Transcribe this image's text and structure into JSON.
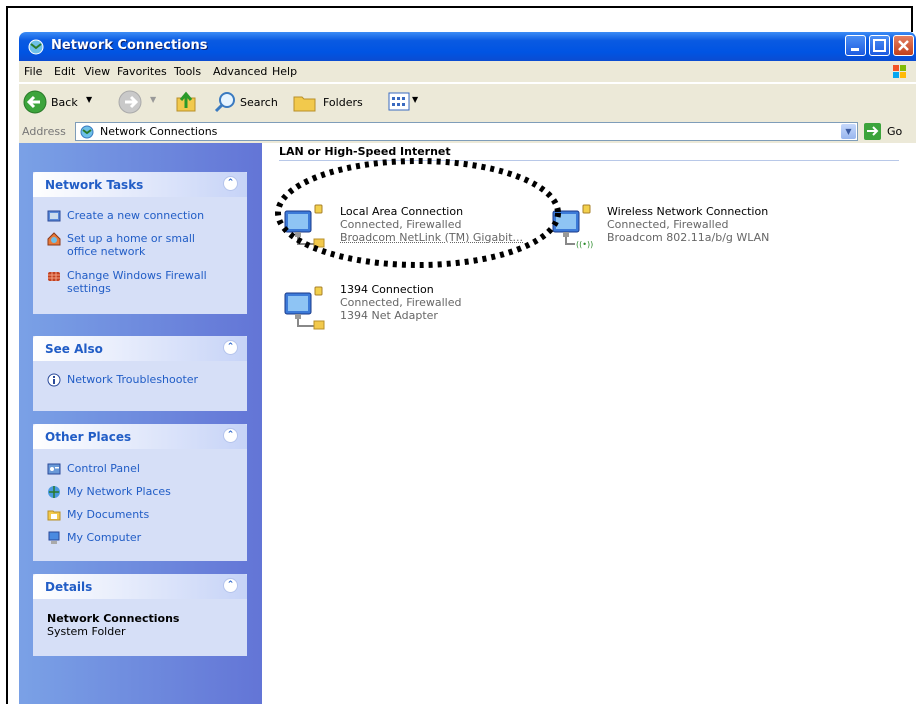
{
  "window": {
    "title": "Network Connections"
  },
  "menu": [
    "File",
    "Edit",
    "View",
    "Favorites",
    "Tools",
    "Advanced",
    "Help"
  ],
  "toolbar": {
    "back": "Back",
    "search": "Search",
    "folders": "Folders"
  },
  "address": {
    "label": "Address",
    "value": "Network Connections",
    "go": "Go"
  },
  "sidebar": {
    "network_tasks": {
      "title": "Network Tasks",
      "items": [
        "Create a new connection",
        "Set up a home or small office network",
        "Change Windows Firewall settings"
      ]
    },
    "see_also": {
      "title": "See Also",
      "items": [
        "Network Troubleshooter"
      ]
    },
    "other_places": {
      "title": "Other Places",
      "items": [
        "Control Panel",
        "My Network Places",
        "My Documents",
        "My Computer"
      ]
    },
    "details": {
      "title": "Details",
      "name": "Network Connections",
      "type": "System Folder"
    }
  },
  "content": {
    "section_title": "LAN or High-Speed Internet",
    "connections": [
      {
        "name": "Local Area Connection",
        "status": "Connected, Firewalled",
        "device": "Broadcom NetLink (TM) Gigabit..."
      },
      {
        "name": "Wireless Network Connection",
        "status": "Connected, Firewalled",
        "device": "Broadcom 802.11a/b/g WLAN"
      },
      {
        "name": "1394 Connection",
        "status": "Connected, Firewalled",
        "device": "1394 Net Adapter"
      }
    ]
  },
  "colors": {
    "titlebar": "#0054e3",
    "sidebar": "#6375d6",
    "link": "#215dc6",
    "chrome": "#ece9d8"
  }
}
